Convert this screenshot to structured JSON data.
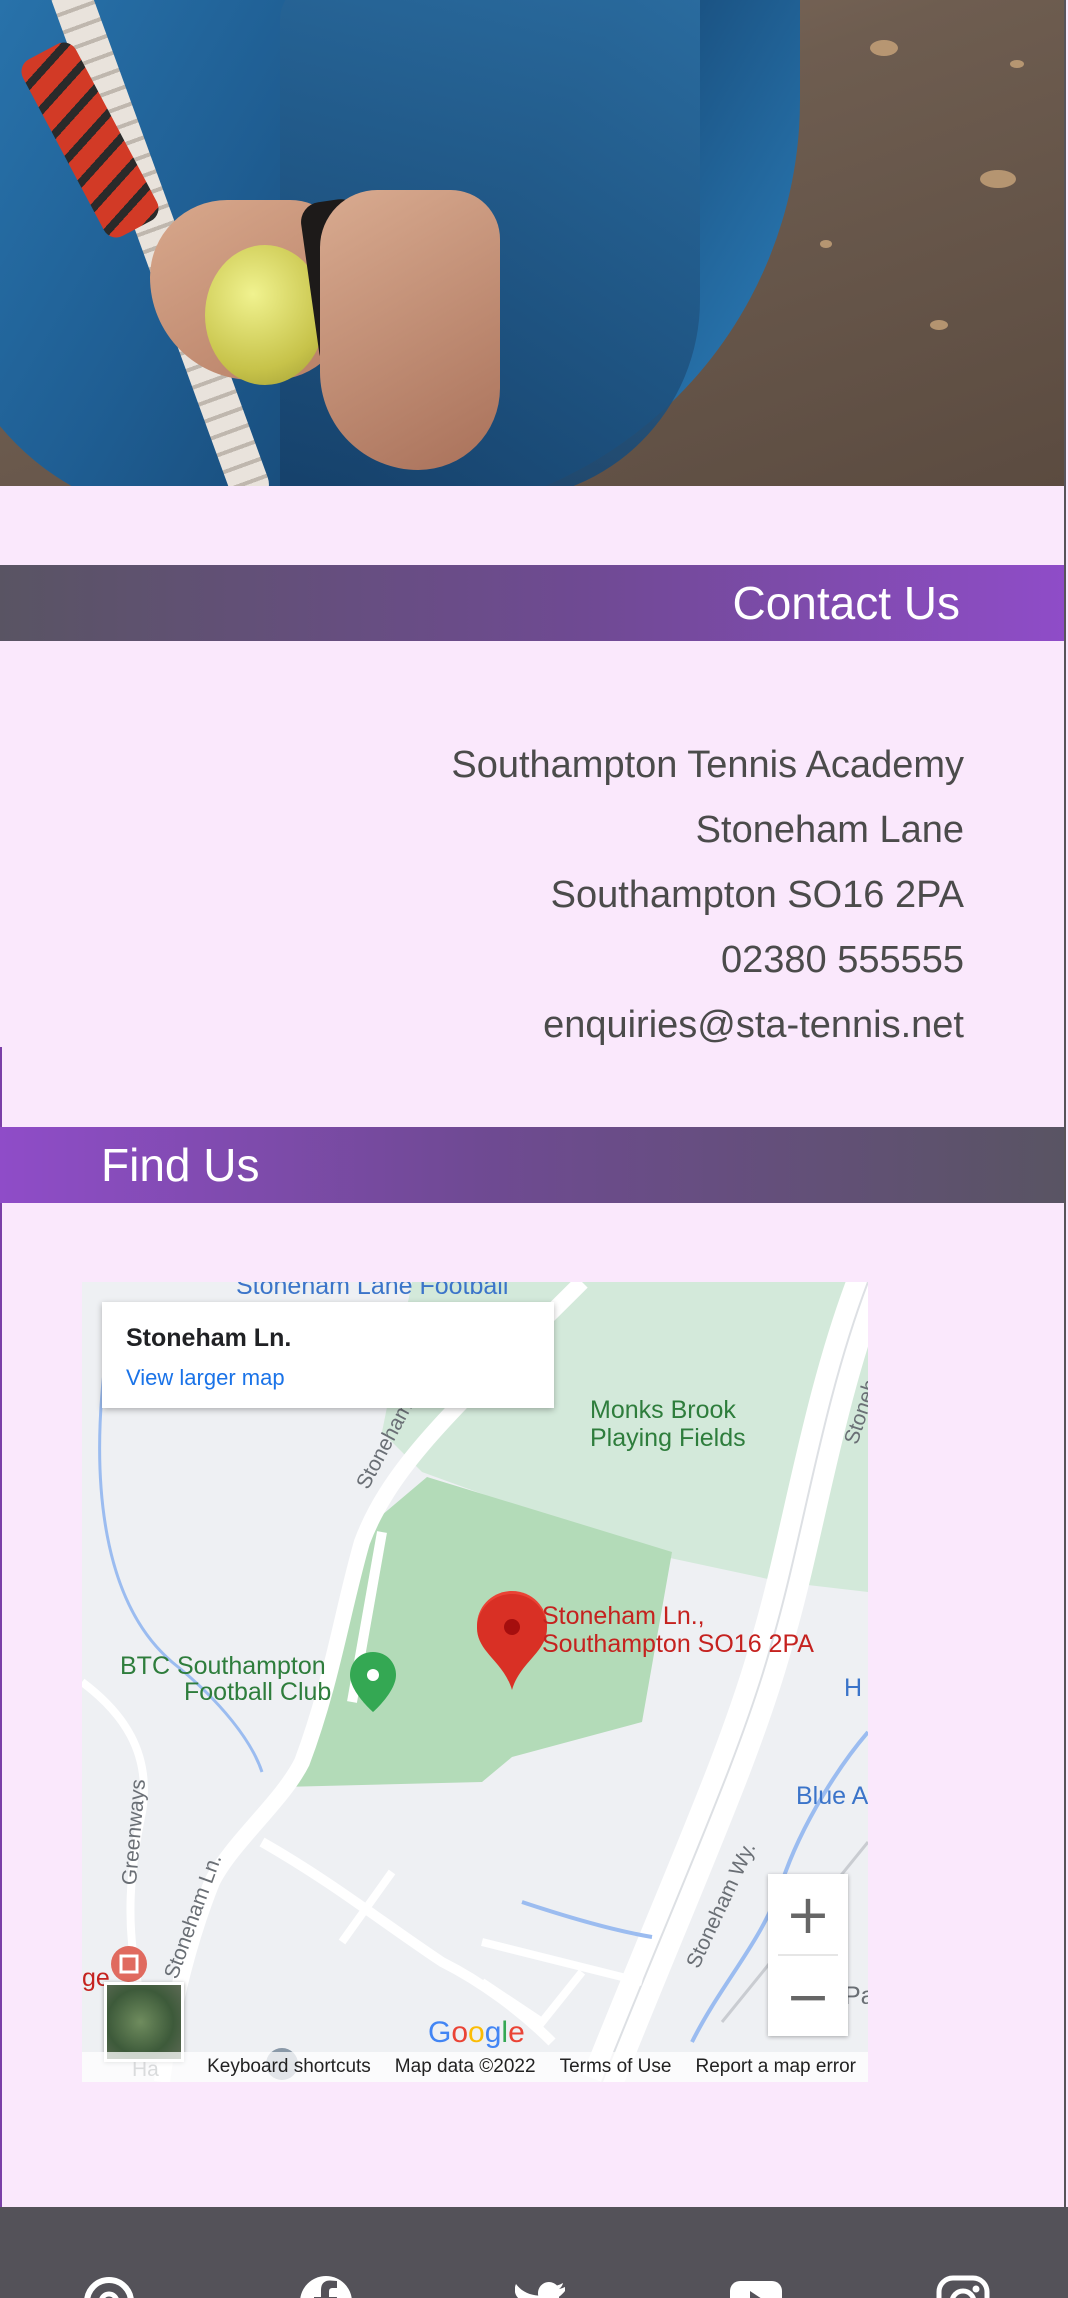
{
  "contact": {
    "heading": "Contact Us",
    "lines": [
      "Southampton Tennis Academy",
      "Stoneham Lane",
      "Southampton SO16 2PA",
      "02380 555555",
      "enquiries@sta-tennis.net"
    ]
  },
  "find": {
    "heading": "Find Us"
  },
  "map": {
    "place_title": "Stoneham Ln.",
    "larger_map_link": "View larger map",
    "labels": {
      "football_top": "Stoneham Lane Football",
      "monks1": "Monks Brook",
      "monks2": "Playing Fields",
      "btc1": "BTC Southampton",
      "btc2": "Football Club",
      "marker1": "Stoneham Ln.,",
      "marker2": "Southampton SO16 2PA",
      "road_ln_top": "Stoneham Ln.",
      "road_ln_bottom": "Stoneham Ln.",
      "road_wy": "Stoneham Wy.",
      "road_right": "Stoneham",
      "greenways": "Greenways",
      "blue_a": "Blue A",
      "h_edge": "H",
      "pa_edge": "Pa",
      "ge_edge": "ge",
      "ha_edge": "Ha"
    },
    "zoom_in": "+",
    "zoom_out": "−",
    "attribution": [
      "Keyboard shortcuts",
      "Map data ©2022",
      "Terms of Use",
      "Report a map error"
    ],
    "logo": "Google"
  },
  "footer": {
    "icons": [
      "threads-icon",
      "facebook-icon",
      "twitter-icon",
      "youtube-icon",
      "instagram-icon"
    ]
  },
  "colors": {
    "band_purple": "#8f4cc8",
    "band_gray": "#595463",
    "page_bg": "#fae8fc",
    "footer": "#545259"
  }
}
